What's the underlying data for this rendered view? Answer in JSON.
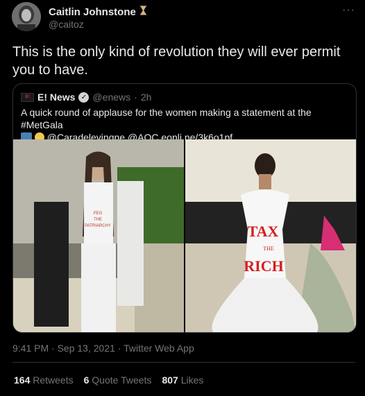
{
  "author": {
    "name": "Caitlin Johnstone",
    "handle": "@caitoz",
    "badge_icon": "hourglass-icon"
  },
  "more_icon": "more-icon",
  "tweet_text": "This is the only kind of revolution they will ever permit you to have.",
  "quote": {
    "logo_text": "E!",
    "name": "E! News",
    "handle": "@enews",
    "separator": "·",
    "time": "2h",
    "text_line1": "A quick round of applause for the women making a statement at the #MetGala",
    "text_line2": "@Caradelevingne @AOC eonli.ne/3k6o1pf",
    "images": {
      "left_sign": [
        "PEG",
        "THE",
        "PATRIARCHY"
      ],
      "right_dress": [
        "TAX",
        "THE",
        "RICH"
      ]
    }
  },
  "timestamp": "9:41 PM · Sep 13, 2021 · Twitter Web App",
  "stats": {
    "retweets_count": "164",
    "retweets_label": "Retweets",
    "quotes_count": "6",
    "quotes_label": "Quote Tweets",
    "likes_count": "807",
    "likes_label": "Likes"
  },
  "colors": {
    "background": "#000000",
    "text": "#e7e9ea",
    "muted": "#71767b",
    "border": "#2f3336"
  }
}
